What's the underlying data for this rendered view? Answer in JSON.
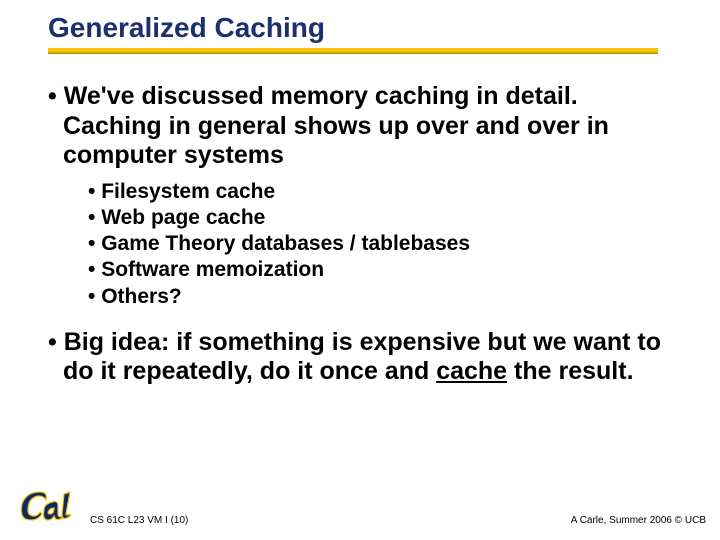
{
  "title": "Generalized Caching",
  "bullets": [
    {
      "text": "We've discussed memory caching in detail.  Caching in general shows up over and over in computer systems",
      "sub": [
        "Filesystem cache",
        "Web page cache",
        "Game Theory databases / tablebases",
        "Software memoization",
        "Others?"
      ]
    },
    {
      "html": "Big idea: if something is expensive but we want to do it repeatedly, do it once and <span class=\"u\">cache</span> the result."
    }
  ],
  "footer": {
    "left": "CS 61C L23 VM I (10)",
    "right": "A Carle, Summer 2006 © UCB"
  }
}
